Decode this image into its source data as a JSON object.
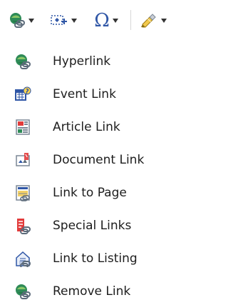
{
  "toolbar": {
    "buttons": [
      {
        "name": "hyperlink-dropdown",
        "icon": "hyperlink-icon"
      },
      {
        "name": "insert-dropdown",
        "icon": "insert-item-icon"
      },
      {
        "name": "special-character-dropdown",
        "icon": "omega-icon",
        "symbol": "Ω"
      },
      {
        "name": "highlighter-dropdown",
        "icon": "highlighter-icon"
      }
    ]
  },
  "menu": {
    "items": [
      {
        "label": "Hyperlink",
        "icon": "hyperlink-icon"
      },
      {
        "label": "Event Link",
        "icon": "event-link-icon"
      },
      {
        "label": "Article Link",
        "icon": "article-link-icon"
      },
      {
        "label": "Document Link",
        "icon": "document-link-icon"
      },
      {
        "label": "Link to Page",
        "icon": "link-to-page-icon"
      },
      {
        "label": "Special Links",
        "icon": "special-links-icon"
      },
      {
        "label": "Link to Listing",
        "icon": "link-to-listing-icon"
      },
      {
        "label": "Remove Link",
        "icon": "remove-link-icon"
      }
    ]
  },
  "colors": {
    "text": "#1d1d1d",
    "toolbar_separator": "#d8d8d8",
    "accent_blue": "#2f56a6",
    "link_green": "#2e8b57",
    "red": "#e23b3b",
    "yellow": "#f2c94c"
  }
}
